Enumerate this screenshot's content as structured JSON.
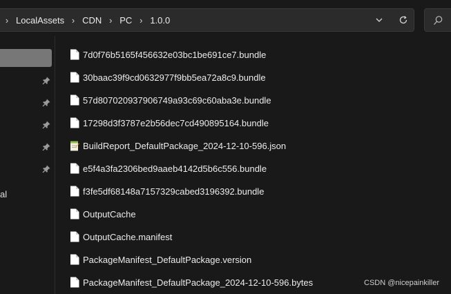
{
  "address_bar": {
    "crumbs": [
      "LocalAssets",
      "CDN",
      "PC",
      "1.0.0"
    ]
  },
  "icons": {
    "breadcrumb_separator": "chevron-right-icon",
    "dropdown": "chevron-down-icon",
    "refresh": "refresh-icon",
    "search": "search-icon",
    "pin": "pin-icon",
    "file": "file-icon",
    "json_file": "json-file-icon"
  },
  "nav": {
    "truncated_label": "al"
  },
  "files": [
    {
      "name": "7d0f76b5165f456632e03bc1be691ce7.bundle",
      "icon": "file"
    },
    {
      "name": "30baac39f9cd0632977f9bb5ea72a8c9.bundle",
      "icon": "file"
    },
    {
      "name": "57d807020937906749a93c69c60aba3e.bundle",
      "icon": "file"
    },
    {
      "name": "17298d3f3787e2b56dec7cd490895164.bundle",
      "icon": "file"
    },
    {
      "name": "BuildReport_DefaultPackage_2024-12-10-596.json",
      "icon": "json"
    },
    {
      "name": "e5f4a3fa2306bed9aaeb4142d5b6c556.bundle",
      "icon": "file"
    },
    {
      "name": "f3fe5df68148a7157329cabed3196392.bundle",
      "icon": "file"
    },
    {
      "name": "OutputCache",
      "icon": "file"
    },
    {
      "name": "OutputCache.manifest",
      "icon": "file"
    },
    {
      "name": "PackageManifest_DefaultPackage.version",
      "icon": "file"
    },
    {
      "name": "PackageManifest_DefaultPackage_2024-12-10-596.bytes",
      "icon": "file"
    }
  ],
  "watermark": "CSDN @nicepainkiller",
  "colors": {
    "background": "#191919",
    "address_bar": "#2b2b2b",
    "nav_selected": "#777777",
    "text": "#ececec"
  }
}
